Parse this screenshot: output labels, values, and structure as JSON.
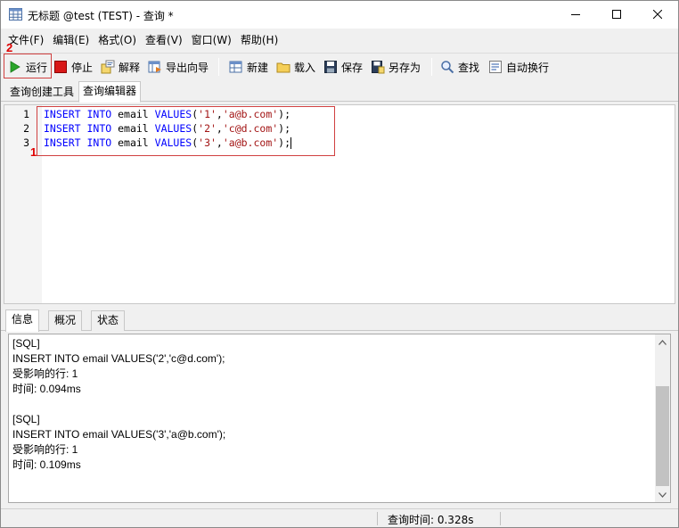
{
  "window": {
    "title": "无标题 @test (TEST) - 查询 *"
  },
  "menu": [
    {
      "label": "文件(F)"
    },
    {
      "label": "编辑(E)"
    },
    {
      "label": "格式(O)"
    },
    {
      "label": "查看(V)"
    },
    {
      "label": "窗口(W)"
    },
    {
      "label": "帮助(H)"
    }
  ],
  "toolbar": {
    "run": "运行",
    "stop": "停止",
    "explain": "解释",
    "export_wizard": "导出向导",
    "new": "新建",
    "load": "载入",
    "save": "保存",
    "save_as": "另存为",
    "find": "查找",
    "word_wrap": "自动换行"
  },
  "annotations": {
    "run_marker": "2",
    "code_marker": "1"
  },
  "editor_tabs": {
    "builder": "查询创建工具",
    "editor": "查询编辑器"
  },
  "editor": {
    "lines": [
      {
        "num": "1",
        "kw1": "INSERT",
        "kw2": "INTO",
        "table": " email ",
        "kw3": "VALUES",
        "open": "(",
        "v1": "'1'",
        "comma": ",",
        "v2": "'a@b.com'",
        "close": ");"
      },
      {
        "num": "2",
        "kw1": "INSERT",
        "kw2": "INTO",
        "table": " email ",
        "kw3": "VALUES",
        "open": "(",
        "v1": "'2'",
        "comma": ",",
        "v2": "'c@d.com'",
        "close": ");"
      },
      {
        "num": "3",
        "kw1": "INSERT",
        "kw2": "INTO",
        "table": " email ",
        "kw3": "VALUES",
        "open": "(",
        "v1": "'3'",
        "comma": ",",
        "v2": "'a@b.com'",
        "close": ");"
      }
    ]
  },
  "result_tabs": {
    "info": "信息",
    "overview": "概况",
    "status": "状态"
  },
  "info": {
    "lines": [
      "[SQL]",
      "INSERT INTO email VALUES('2','c@d.com');",
      "受影响的行: 1",
      "时间: 0.094ms",
      "",
      "[SQL]",
      "INSERT INTO email VALUES('3','a@b.com');",
      "受影响的行: 1",
      "时间: 0.109ms"
    ]
  },
  "status": {
    "query_time": "查询时间: 0.328s"
  }
}
